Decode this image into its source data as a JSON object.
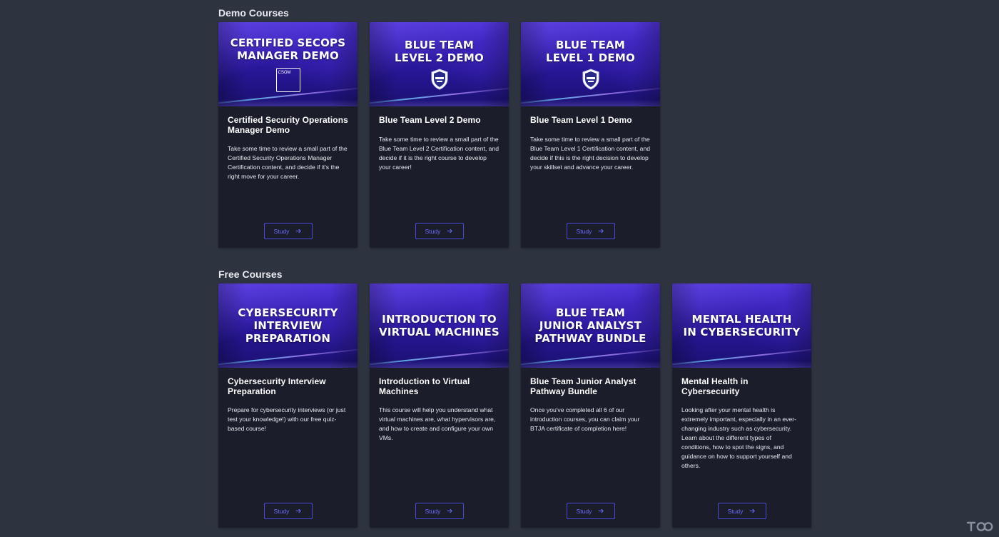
{
  "demo": {
    "title": "Demo Courses",
    "cards": [
      {
        "banner_title": "CERTIFIED SECOPS\nMANAGER DEMO",
        "emblem": "csom-badge",
        "emblem_text": "CSOM",
        "title": "Certified Security Operations Manager Demo",
        "description": "Take some time to review a small part of the Certified Security Operations Manager Certification content, and decide if it's the right move for your career.",
        "button": "Study"
      },
      {
        "banner_title": "BLUE TEAM\nLEVEL 2 DEMO",
        "emblem": "blue-team-shield",
        "title": "Blue Team Level 2 Demo",
        "description": "Take some time to review a small part of the Blue Team Level 2 Certification content, and decide if it is the right course to develop your career!",
        "button": "Study"
      },
      {
        "banner_title": "BLUE TEAM\nLEVEL 1 DEMO",
        "emblem": "blue-team-shield",
        "title": "Blue Team Level 1 Demo",
        "description": "Take some time to review a small part of the Blue Team Level 1 Certification content, and decide if this is the right decision to develop your skillset and advance your career.",
        "button": "Study"
      }
    ]
  },
  "free": {
    "title": "Free Courses",
    "cards": [
      {
        "banner_title": "CYBERSECURITY\nINTERVIEW\nPREPARATION",
        "title": "Cybersecurity Interview Preparation",
        "description": "Prepare for cybersecurity interviews (or just test your knowledge!) with our free quiz-based course!",
        "button": "Study"
      },
      {
        "banner_title": "INTRODUCTION TO\nVIRTUAL MACHINES",
        "title": "Introduction to Virtual Machines",
        "description": "This course will help you understand what virtual machines are, what hypervisors are, and how to create and configure your own VMs.",
        "button": "Study"
      },
      {
        "banner_title": "BLUE TEAM\nJUNIOR ANALYST\nPATHWAY BUNDLE",
        "title": "Blue Team Junior Analyst Pathway Bundle",
        "description": "Once you've completed all 6 of our introduction courses, you can claim your BTJA certificate of completion here!",
        "button": "Study"
      },
      {
        "banner_title": "MENTAL HEALTH\nIN CYBERSECURITY",
        "title": "Mental Health in Cybersecurity",
        "description": "Looking after your mental health is extremely important, especially in an ever-changing industry such as cybersecurity. Learn about the different types of conditions, how to spot the signs, and guidance on how to support yourself and others.",
        "button": "Study"
      }
    ]
  },
  "colors": {
    "background": "#2e3340",
    "card": "#1b1e2a",
    "accent": "#5552f0",
    "banner": "#2a17a0"
  }
}
